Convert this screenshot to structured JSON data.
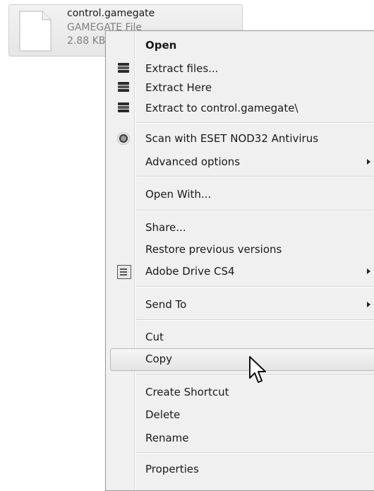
{
  "file": {
    "name": "control.gamegate",
    "type": "GAMEGATE File",
    "size": "2.88 KB"
  },
  "menu": {
    "open": "Open",
    "extract_files": "Extract files...",
    "extract_here": "Extract Here",
    "extract_to": "Extract to control.gamegate\\",
    "scan": "Scan with ESET NOD32 Antivirus",
    "advanced": "Advanced options",
    "open_with": "Open With...",
    "share": "Share...",
    "restore": "Restore previous versions",
    "adobe_drive": "Adobe Drive CS4",
    "send_to": "Send To",
    "cut": "Cut",
    "copy": "Copy",
    "create_shortcut": "Create Shortcut",
    "delete": "Delete",
    "rename": "Rename",
    "properties": "Properties"
  },
  "icons": {
    "archive": "winrar-archive-icon",
    "antivirus": "eset-icon",
    "drive": "adobe-drive-icon",
    "submenu": "submenu-arrow-icon",
    "pointer": "mouse-cursor-icon"
  },
  "highlighted_item": "Copy"
}
